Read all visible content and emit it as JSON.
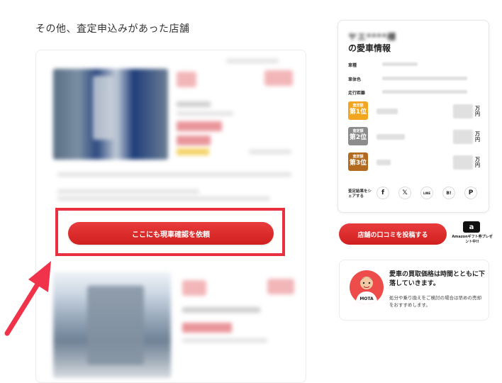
{
  "section_title": "その他、査定申込みがあった店舗",
  "cta": {
    "label": "ここにも現車確認を依頼"
  },
  "car_info": {
    "owner_name": "ヤエ****様",
    "title": "の愛車情報",
    "specs": [
      {
        "label": "車種"
      },
      {
        "label": "車体色"
      },
      {
        "label": "走行距離"
      }
    ],
    "ranks": [
      {
        "small": "査定額",
        "large": "第1位",
        "color": "#f2a51f",
        "unit": "万円"
      },
      {
        "small": "査定額",
        "large": "第2位",
        "color": "#8c8c8c",
        "unit": "万円"
      },
      {
        "small": "査定額",
        "large": "第3位",
        "color": "#b26a1e",
        "unit": "万円"
      }
    ],
    "share_label": "査定結果をシェアする",
    "share_icons": [
      "facebook-icon",
      "x-icon",
      "line-icon",
      "hatena-bookmark-icon",
      "pinterest-icon"
    ],
    "share_glyphs": [
      "f",
      "𝕏",
      "LINE",
      "B!",
      "P"
    ]
  },
  "review": {
    "button_label": "店舗の口コミを投稿する",
    "amazon_logo": "a",
    "amazon_text": "Amazonギフト券プレゼント中!!"
  },
  "advice": {
    "headline": "愛車の買取価格は時間とともに下落していきます。",
    "body": "処分や乗り換えをご検討の場合は早めの売却をおすすめします。",
    "avatar_shirt": "MOTA"
  },
  "colors": {
    "primary_red": "#d82424",
    "highlight_red": "#e8303f",
    "arrow": "#f0334a"
  }
}
